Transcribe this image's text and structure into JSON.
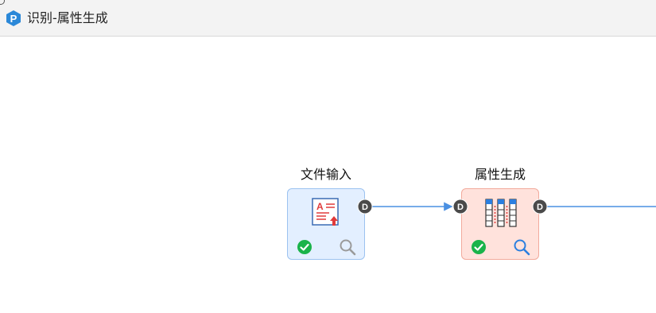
{
  "window": {
    "title": "识别-属性生成",
    "app_icon": "p-logo-icon",
    "accent": "#2b88d8"
  },
  "canvas": {
    "nodes": [
      {
        "id": "file_input",
        "label": "文件输入",
        "icon": "file-upload-icon",
        "status_icon": "check-circle-icon",
        "preview_icon": "magnifier-icon",
        "preview_active": false,
        "theme": "blue",
        "output_port": "D"
      },
      {
        "id": "attribute_generation",
        "label": "属性生成",
        "icon": "columns-table-icon",
        "status_icon": "check-circle-icon",
        "preview_icon": "magnifier-icon",
        "preview_active": true,
        "theme": "salmon",
        "input_port": "D",
        "output_port": "D"
      }
    ],
    "connections": [
      {
        "from": "file_input",
        "to": "attribute_generation"
      },
      {
        "from": "attribute_generation",
        "to": "next-step-offscreen"
      }
    ],
    "colors": {
      "edge": "#4a90e2",
      "ok_green": "#1ab34a",
      "port_dark": "#4a4a4a",
      "preview_active": "#2b7fe0",
      "preview_inactive": "#9a9a9a"
    }
  }
}
